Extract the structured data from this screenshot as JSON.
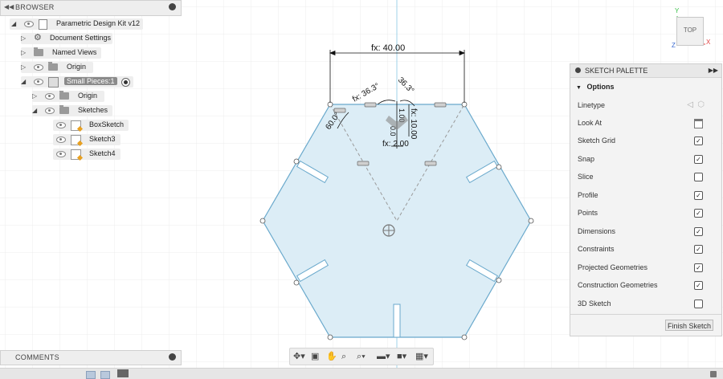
{
  "browser": {
    "title": "BROWSER",
    "items": [
      {
        "label": "Parametric Design Kit v12"
      },
      {
        "label": "Document Settings"
      },
      {
        "label": "Named Views"
      },
      {
        "label": "Origin"
      },
      {
        "label": "Small Pieces:1"
      },
      {
        "label": "Origin"
      },
      {
        "label": "Sketches"
      },
      {
        "label": "BoxSketch"
      },
      {
        "label": "Sketch3"
      },
      {
        "label": "Sketch4"
      }
    ]
  },
  "comments": {
    "title": "COMMENTS"
  },
  "viewcube": {
    "face": "TOP",
    "axis_x": "X",
    "axis_y": "Y",
    "axis_z": "Z"
  },
  "dimensions": {
    "width": "fx: 40.00",
    "angle_left": "fx: 36.3°",
    "angle_right": "36.3°",
    "angle_corner": "60.0°",
    "depth": "fx: 10.00",
    "slot": "fx: 2.00",
    "small_a": "1.00",
    "small_b": "0.0"
  },
  "palette": {
    "title": "SKETCH PALETTE",
    "section": "Options",
    "options": [
      {
        "label": "Linetype",
        "kind": "linetype"
      },
      {
        "label": "Look At",
        "kind": "lookat"
      },
      {
        "label": "Sketch Grid",
        "checked": true
      },
      {
        "label": "Snap",
        "checked": true
      },
      {
        "label": "Slice",
        "checked": false
      },
      {
        "label": "Profile",
        "checked": true
      },
      {
        "label": "Points",
        "checked": true
      },
      {
        "label": "Dimensions",
        "checked": true
      },
      {
        "label": "Constraints",
        "checked": true
      },
      {
        "label": "Projected Geometries",
        "checked": true
      },
      {
        "label": "Construction Geometries",
        "checked": true
      },
      {
        "label": "3D Sketch",
        "checked": false
      }
    ],
    "finish_label": "Finish Sketch"
  },
  "colors": {
    "profile_fill": "#dcedf6",
    "sketch_line": "#6aa9cc",
    "canvas_bg": "#ffffff",
    "grid": "#ececec",
    "axis": "#9fd3e8"
  }
}
